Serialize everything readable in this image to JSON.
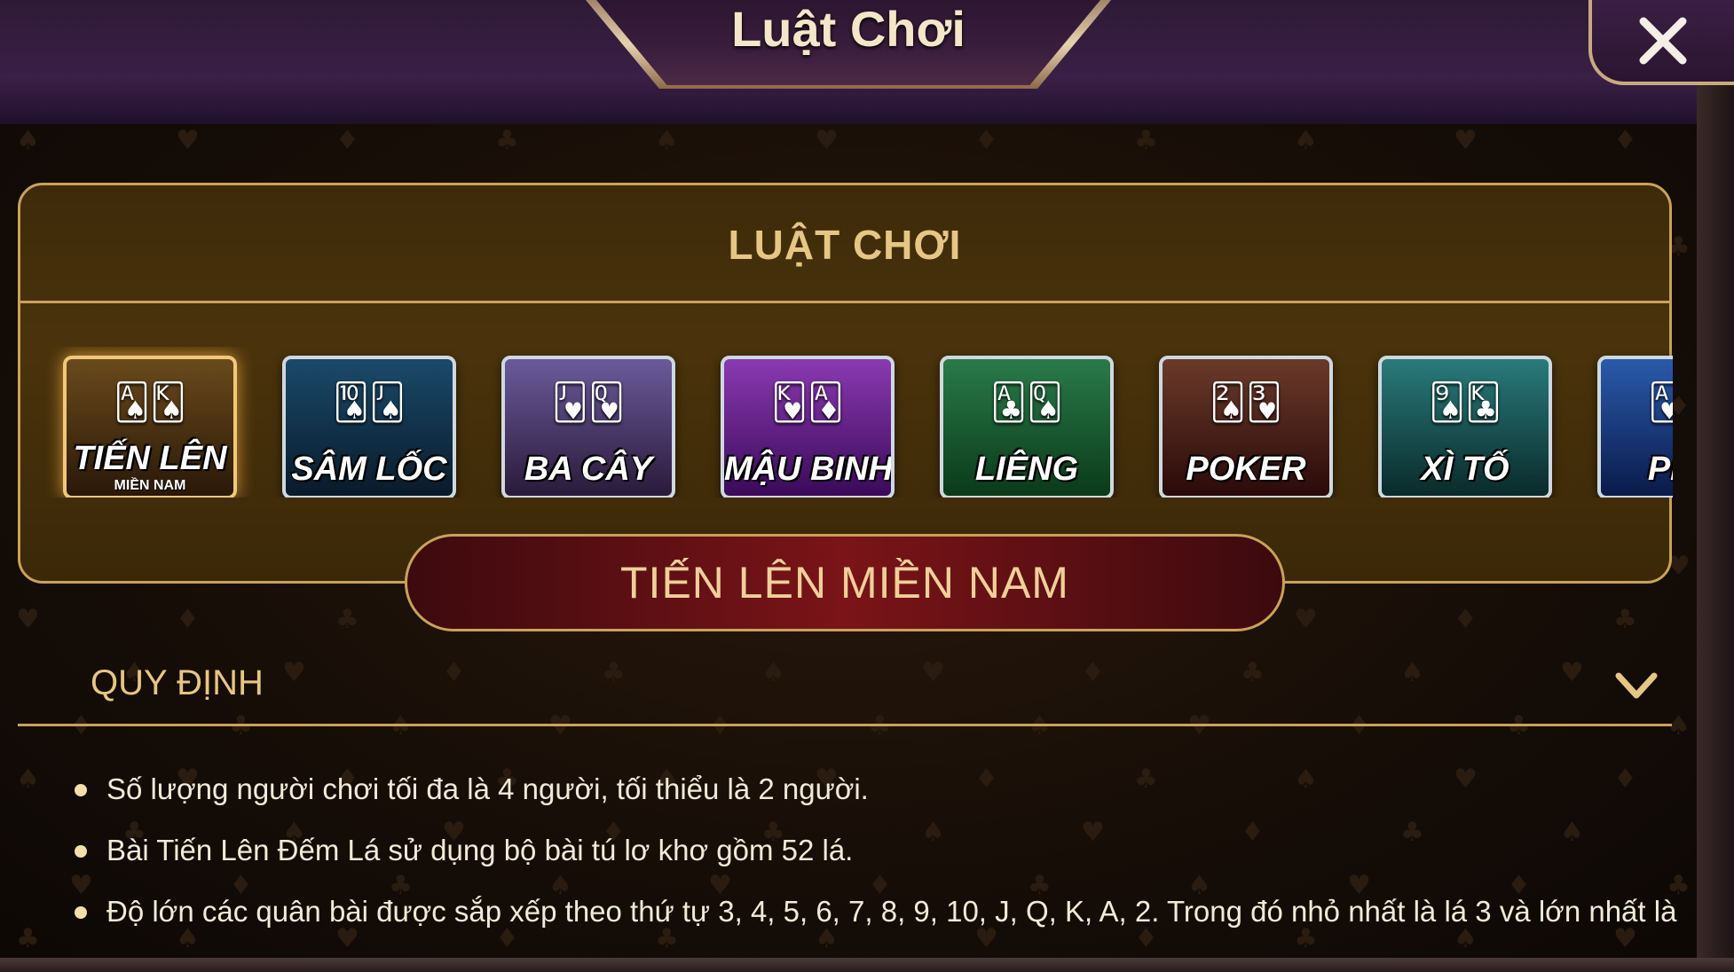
{
  "header": {
    "title": "Luật Chơi",
    "close_icon": "close-icon"
  },
  "panel": {
    "title": "LUẬT CHƠI",
    "games": [
      {
        "label": "TIẾN LÊN",
        "sub": "MIỀN NAM",
        "selected": true,
        "color_top": "#6a4a1c",
        "color_bottom": "#2a1808"
      },
      {
        "label": "SÂM LỐC",
        "sub": "",
        "selected": false,
        "color_top": "#1a4a6a",
        "color_bottom": "#0a1a2a"
      },
      {
        "label": "BA CÂY",
        "sub": "",
        "selected": false,
        "color_top": "#6a5a9a",
        "color_bottom": "#2a1a3a"
      },
      {
        "label": "MẬU BINH",
        "sub": "",
        "selected": false,
        "color_top": "#8a3ab0",
        "color_bottom": "#3a0a5a"
      },
      {
        "label": "LIÊNG",
        "sub": "",
        "selected": false,
        "color_top": "#2a7a4a",
        "color_bottom": "#0a3a1a"
      },
      {
        "label": "POKER",
        "sub": "",
        "selected": false,
        "color_top": "#6a3a2a",
        "color_bottom": "#2a0a0a"
      },
      {
        "label": "XÌ TỐ",
        "sub": "",
        "selected": false,
        "color_top": "#2a7a7a",
        "color_bottom": "#0a2a2a"
      },
      {
        "label": "PHỎ",
        "sub": "",
        "selected": false,
        "color_top": "#2a5aaa",
        "color_bottom": "#0a1a4a"
      }
    ]
  },
  "selected_game": "TIẾN LÊN MIỀN NAM",
  "rules_section": {
    "title": "QUY ĐỊNH",
    "expand_icon": "chevron-down-icon",
    "items": [
      "Số lượng người chơi tối đa là 4 người, tối thiểu là 2 người.",
      "Bài Tiến Lên Đếm Lá sử dụng bộ bài tú lơ khơ gồm 52 lá.",
      "Độ lớn các quân bài được sắp xếp theo thứ tự 3, 4, 5, 6, 7, 8, 9, 10, J, Q, K, A, 2. Trong đó nhỏ nhất là lá 3 và lớn nhất là"
    ]
  },
  "colors": {
    "gold": "#c9a25a",
    "gold_text": "#e6c684",
    "banner_red": "#7a1418",
    "rule_text": "#f2ead8"
  }
}
